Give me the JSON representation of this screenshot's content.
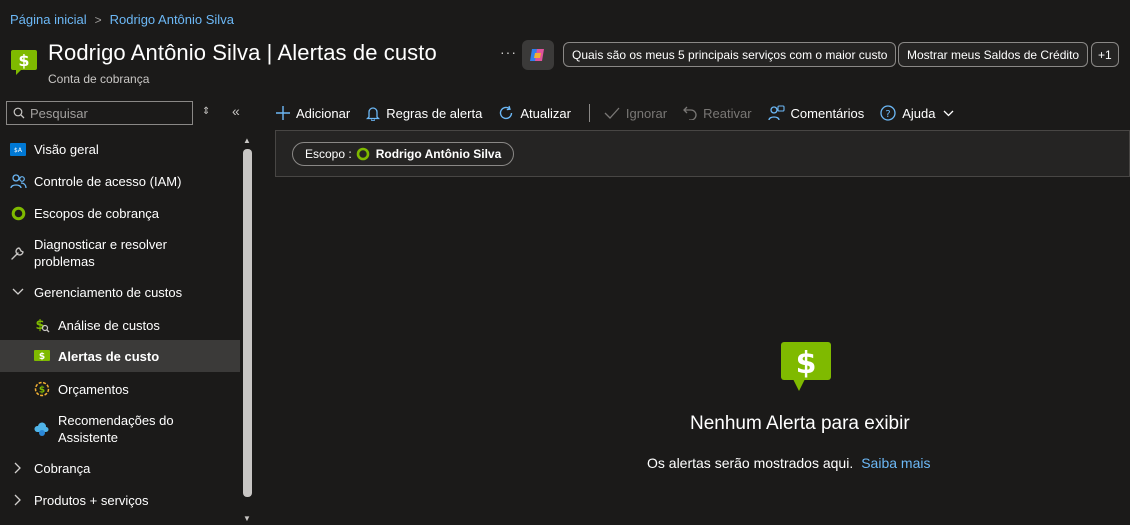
{
  "breadcrumb": {
    "home": "Página inicial",
    "current": "Rodrigo Antônio Silva"
  },
  "header": {
    "title": "Rodrigo Antônio Silva | Alertas de custo",
    "subtitle": "Conta de cobrança",
    "more": "···",
    "chips": [
      "Quais são os meus 5 principais serviços com o maior custo",
      "Mostrar meus Saldos de Crédito",
      "+1"
    ]
  },
  "sidebar": {
    "search_placeholder": "Pesquisar",
    "sort_icon": "⇕",
    "collapse_icon": "«",
    "items": [
      {
        "label": "Visão geral",
        "icon": "overview-icon"
      },
      {
        "label": "Controle de acesso (IAM)",
        "icon": "people-icon"
      },
      {
        "label": "Escopos de cobrança",
        "icon": "scope-ring-icon"
      },
      {
        "label": "Diagnosticar e resolver problemas",
        "icon": "wrench-icon"
      },
      {
        "label": "Gerenciamento de custos",
        "icon": "chevron-down-icon"
      },
      {
        "label": "Análise de custos",
        "icon": "cost-analysis-icon"
      },
      {
        "label": "Alertas de custo",
        "icon": "cost-alert-icon"
      },
      {
        "label": "Orçamentos",
        "icon": "budget-icon"
      },
      {
        "label": "Recomendações do Assistente",
        "icon": "advisor-icon"
      },
      {
        "label": "Cobrança",
        "icon": "chevron-right-icon"
      },
      {
        "label": "Produtos + serviços",
        "icon": "chevron-right-icon"
      }
    ]
  },
  "toolbar": {
    "add": "Adicionar",
    "alert_rules": "Regras de alerta",
    "refresh": "Atualizar",
    "ignore": "Ignorar",
    "reactivate": "Reativar",
    "feedback": "Comentários",
    "help": "Ajuda"
  },
  "filter": {
    "scope_label": "Escopo :",
    "scope_value": "Rodrigo Antônio Silva"
  },
  "empty_state": {
    "title": "Nenhum Alerta para exibir",
    "message": "Os alertas serão mostrados aqui.",
    "link": "Saiba mais"
  },
  "colors": {
    "accent": "#6cb8f6",
    "brand_green": "#7fba00",
    "background": "#1b1a19"
  }
}
